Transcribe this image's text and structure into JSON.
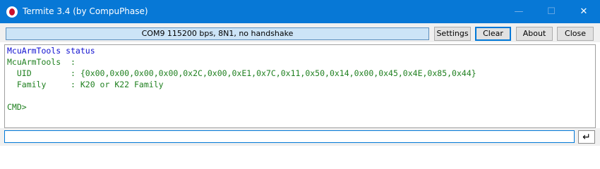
{
  "window": {
    "title": "Termite 3.4 (by CompuPhase)",
    "minimize_glyph": "—",
    "maximize_glyph": "☐",
    "close_glyph": "✕"
  },
  "toolbar": {
    "status": "COM9 115200 bps, 8N1, no handshake",
    "settings_label": "Settings",
    "clear_label": "Clear",
    "about_label": "About",
    "close_label": "Close"
  },
  "terminal": {
    "lines": [
      {
        "text": "McuArmTools status",
        "color": "#1010d0"
      },
      {
        "text": "McuArmTools  :",
        "color": "#208020"
      },
      {
        "text": "  UID        : {0x00,0x00,0x00,0x00,0x2C,0x00,0xE1,0x7C,0x11,0x50,0x14,0x00,0x45,0x4E,0x85,0x44}",
        "color": "#208020"
      },
      {
        "text": "  Family     : K20 or K22 Family",
        "color": "#208020"
      },
      {
        "text": "",
        "color": "#208020"
      },
      {
        "text": "CMD>",
        "color": "#208020"
      }
    ]
  },
  "input": {
    "value": "",
    "enter_glyph": "↵"
  },
  "colors": {
    "titlebar": "#0778d6",
    "status_bg": "#cce4f7",
    "header_text": "#1010d0",
    "output_text": "#208020"
  }
}
